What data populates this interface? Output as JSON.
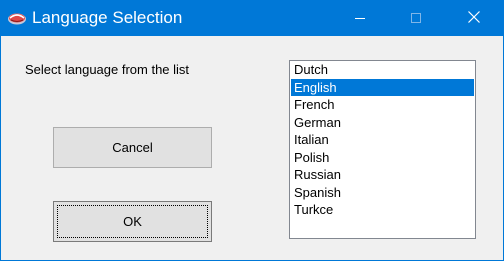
{
  "window": {
    "title": "Language Selection",
    "accent_color": "#0078d7",
    "icon": "app-globe-icon",
    "controls": {
      "minimize_icon": "minimize-icon",
      "maximize_icon": "maximize-icon",
      "close_icon": "close-icon"
    }
  },
  "dialog": {
    "prompt": "Select language from the list",
    "cancel_label": "Cancel",
    "ok_label": "OK"
  },
  "languages": {
    "selected_index": 1,
    "items": [
      "Dutch",
      "English",
      "French",
      "German",
      "Italian",
      "Polish",
      "Russian",
      "Spanish",
      "Turkce"
    ]
  }
}
